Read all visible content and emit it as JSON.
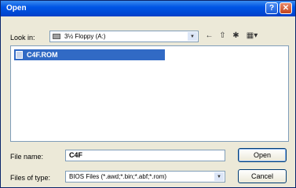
{
  "window": {
    "title": "Open"
  },
  "titlebar": {
    "help_glyph": "?",
    "close_glyph": "✕"
  },
  "lookin": {
    "label": "Look in:",
    "value": "3½ Floppy (A:)",
    "icon": "floppy-drive-icon"
  },
  "toolbar": {
    "back_glyph": "←",
    "up_glyph": "⇧",
    "new_folder_glyph": "✱",
    "views_glyph": "▦▾"
  },
  "files": [
    {
      "name": "C4F.ROM",
      "icon": "file-icon",
      "selected": true
    }
  ],
  "filename": {
    "label": "File name:",
    "value": "C4F"
  },
  "filetype": {
    "label": "Files of type:",
    "value": "BIOS Files (*.awd;*.bin;*.abf;*.rom)"
  },
  "buttons": {
    "open": "Open",
    "cancel": "Cancel"
  },
  "colors": {
    "titlebar": "#0055e5",
    "selection": "#316ac5",
    "dialog_bg": "#ece9d8"
  }
}
